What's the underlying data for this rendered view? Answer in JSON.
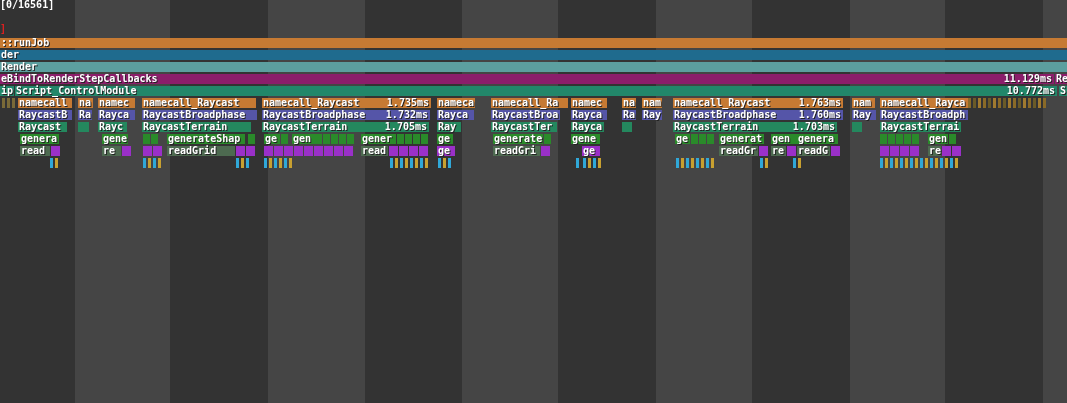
{
  "header": {
    "counter": "[0/16561]",
    "marker": "]"
  },
  "rows": [
    {
      "blocks": [
        {
          "label": "::runJob",
          "color": "#c67a33"
        }
      ]
    },
    {
      "blocks": [
        {
          "label": "der",
          "color": "#1f6b8e"
        }
      ]
    },
    {
      "blocks": [
        {
          "label": "Render",
          "color": "#5c9f9f"
        }
      ]
    },
    {
      "blocks": [
        {
          "label": "eBindToRenderStepCallbacks",
          "duration": "11.129ms",
          "color": "#8b1e6b"
        },
        {
          "label": "Re",
          "color": "#8b1e6b"
        }
      ]
    },
    {
      "blocks": [
        {
          "label": "ip",
          "color": "#22876a"
        },
        {
          "label": "Script_ControlModule",
          "duration": "10.772ms",
          "color": "#22876a"
        },
        {
          "label": "S",
          "color": "#22876a"
        }
      ]
    },
    {
      "blocks": [
        {
          "label": "namecall",
          "color": "#c67a33"
        },
        {
          "label": "na",
          "color": "#c67a33"
        },
        {
          "label": "namec",
          "color": "#c67a33"
        },
        {
          "label": "namecall_Raycast",
          "color": "#c67a33"
        },
        {
          "label": "namecall_Raycast",
          "duration": "1.735ms",
          "color": "#c67a33"
        },
        {
          "label": "nameca",
          "color": "#c67a33"
        },
        {
          "label": "namecall_Ra",
          "color": "#c67a33"
        },
        {
          "label": "namec",
          "color": "#c67a33"
        },
        {
          "label": "na",
          "color": "#c67a33"
        },
        {
          "label": "nam",
          "color": "#c67a33"
        },
        {
          "label": "namecall_Raycast",
          "duration": "1.763ms",
          "color": "#c67a33"
        },
        {
          "label": "nam",
          "color": "#c67a33"
        },
        {
          "label": "namecall_Rayca",
          "color": "#c67a33"
        }
      ]
    },
    {
      "blocks": [
        {
          "label": "RaycastB",
          "color": "#5555a8"
        },
        {
          "label": "Ra",
          "color": "#5555a8"
        },
        {
          "label": "Rayca",
          "color": "#5555a8"
        },
        {
          "label": "RaycastBroadphase",
          "color": "#5555a8"
        },
        {
          "label": "RaycastBroadphase",
          "duration": "1.732ms",
          "color": "#5555a8"
        },
        {
          "label": "Rayca",
          "color": "#5555a8"
        },
        {
          "label": "RaycastBroa",
          "color": "#5555a8"
        },
        {
          "label": "Rayca",
          "color": "#5555a8"
        },
        {
          "label": "Ra",
          "color": "#5555a8"
        },
        {
          "label": "Ray",
          "color": "#5555a8"
        },
        {
          "label": "RaycastBroadphase",
          "duration": "1.760ms",
          "color": "#5555a8"
        },
        {
          "label": "Ray",
          "color": "#5555a8"
        },
        {
          "label": "RaycastBroadph",
          "color": "#5555a8"
        }
      ]
    },
    {
      "blocks": [
        {
          "label": "Raycast",
          "color": "#24885e"
        },
        {
          "label": "Rayc",
          "color": "#24885e"
        },
        {
          "label": "RaycastTerrain",
          "color": "#24885e"
        },
        {
          "label": "RaycastTerrain",
          "duration": "1.705ms",
          "color": "#24885e"
        },
        {
          "label": "Ray",
          "color": "#24885e"
        },
        {
          "label": "RaycastTer",
          "color": "#24885e"
        },
        {
          "label": "Rayca",
          "color": "#24885e"
        },
        {
          "label": "RaycastTerrain",
          "duration": "1.703ms",
          "color": "#24885e"
        },
        {
          "label": "RaycastTerrai",
          "color": "#24885e"
        }
      ]
    },
    {
      "blocks": [
        {
          "label": "genera",
          "color": "#2a8a2a"
        },
        {
          "label": "gene",
          "color": "#2a8a2a"
        },
        {
          "label": "generateShap",
          "color": "#2a8a2a"
        },
        {
          "label": "ge",
          "color": "#2a8a2a"
        },
        {
          "label": "gen",
          "color": "#2a8a2a"
        },
        {
          "label": "gener",
          "color": "#2a8a2a"
        },
        {
          "label": "ge",
          "color": "#2a8a2a"
        },
        {
          "label": "generate",
          "color": "#2a8a2a"
        },
        {
          "label": "gene",
          "color": "#2a8a2a"
        },
        {
          "label": "ge",
          "color": "#2a8a2a"
        },
        {
          "label": "generat",
          "color": "#2a8a2a"
        },
        {
          "label": "gen",
          "color": "#2a8a2a"
        },
        {
          "label": "genera",
          "color": "#2a8a2a"
        },
        {
          "label": "gen",
          "color": "#2a8a2a"
        }
      ]
    },
    {
      "blocks": [
        {
          "label": "read",
          "color": "#4d6a50"
        },
        {
          "label": "re",
          "color": "#4d6a50"
        },
        {
          "label": "readGrid",
          "color": "#4d6a50"
        },
        {
          "label": "read",
          "color": "#4d6a50"
        },
        {
          "label": "ge",
          "color": "#9a30c8"
        },
        {
          "label": "readGri",
          "color": "#4d6a50"
        },
        {
          "label": "ge",
          "color": "#9a30c8"
        },
        {
          "label": "readGr",
          "color": "#4d6a50"
        },
        {
          "label": "re",
          "color": "#4d6a50"
        },
        {
          "label": "readG",
          "color": "#4d6a50"
        },
        {
          "label": "re",
          "color": "#4d6a50"
        }
      ]
    }
  ]
}
